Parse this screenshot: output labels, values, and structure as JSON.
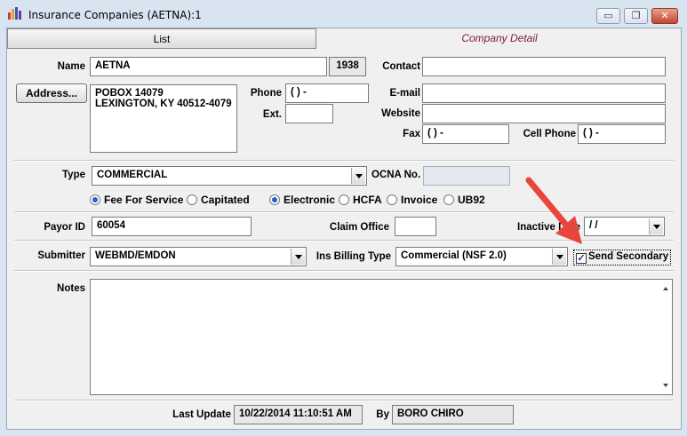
{
  "window": {
    "title": "Insurance Companies (AETNA):1",
    "minimize": "▭",
    "restore": "❐",
    "close": "✕"
  },
  "tabs": {
    "list": "List",
    "detail": "Company Detail"
  },
  "name": {
    "label": "Name",
    "value": "AETNA",
    "id": "1938"
  },
  "contact": {
    "label": "Contact",
    "value": ""
  },
  "address": {
    "button": "Address...",
    "line1": "POBOX 14079",
    "line2": "LEXINGTON, KY 40512-4079"
  },
  "phone": {
    "label": "Phone",
    "value": "(   )    -",
    "ext_label": "Ext.",
    "ext_value": ""
  },
  "email": {
    "label": "E-mail",
    "value": ""
  },
  "website": {
    "label": "Website",
    "value": ""
  },
  "fax": {
    "label": "Fax",
    "value": "(   )    -"
  },
  "cell": {
    "label": "Cell Phone",
    "value": "(   )    -"
  },
  "type": {
    "label": "Type",
    "value": "COMMERCIAL"
  },
  "ocna": {
    "label": "OCNA No.",
    "value": ""
  },
  "payment_options": {
    "fee_for_service": "Fee For Service",
    "capitated": "Capitated",
    "selected": "Fee For Service"
  },
  "claim_format_options": {
    "electronic": "Electronic",
    "hcfa": "HCFA",
    "invoice": "Invoice",
    "ub92": "UB92",
    "selected": "Electronic"
  },
  "payor": {
    "label": "Payor ID",
    "value": "60054"
  },
  "claim_office": {
    "label": "Claim Office",
    "value": ""
  },
  "inactive": {
    "label": "Inactive Date",
    "value": " /  /"
  },
  "submitter": {
    "label": "Submitter",
    "value": "WEBMD/EMDON"
  },
  "ins_billing": {
    "label": "Ins Billing Type",
    "value": "Commercial (NSF 2.0)"
  },
  "send_secondary": {
    "label": "Send Secondary",
    "checked": "✓"
  },
  "notes": {
    "label": "Notes",
    "value": ""
  },
  "last_update": {
    "label": "Last Update",
    "value": "10/22/2014 11:10:51 AM",
    "by_label": "By",
    "by_value": "BORO CHIRO"
  },
  "icons": {
    "app": "bar-chart-icon",
    "annotation": "red-arrow-icon"
  },
  "colors": {
    "arrow": "#e8453c",
    "tab_detail_text": "#7a1a46",
    "radio_selected": "#1f5fd0"
  }
}
